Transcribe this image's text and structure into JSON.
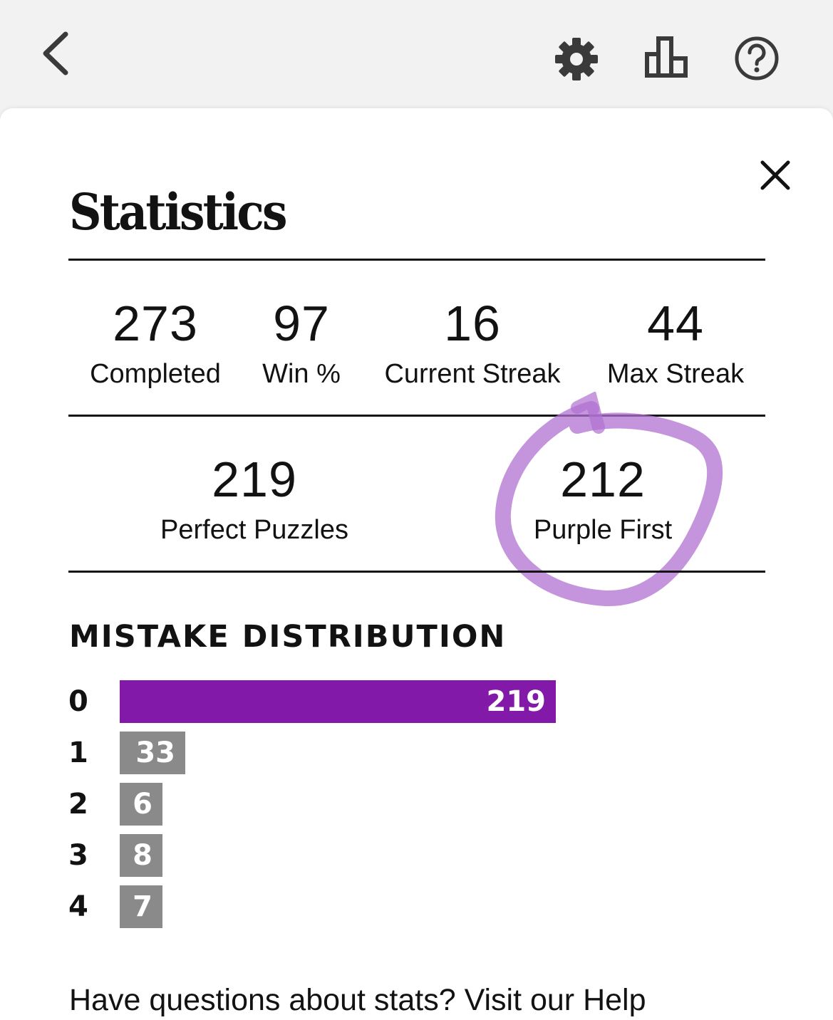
{
  "header": {
    "back_icon": "chevron-left-icon",
    "settings_icon": "gear-icon",
    "stats_icon": "bar-chart-icon",
    "help_icon": "question-circle-icon"
  },
  "modal": {
    "title": "Statistics",
    "close_icon": "close-icon"
  },
  "stats": {
    "completed": {
      "value": "273",
      "label": "Completed"
    },
    "win_pct": {
      "value": "97",
      "label": "Win %"
    },
    "current_streak": {
      "value": "16",
      "label": "Current Streak"
    },
    "max_streak": {
      "value": "44",
      "label": "Max Streak"
    },
    "perfect_puzzles": {
      "value": "219",
      "label": "Perfect Puzzles"
    },
    "purple_first": {
      "value": "212",
      "label": "Purple First"
    }
  },
  "distribution": {
    "title": "MISTAKE DISTRIBUTION",
    "rows": [
      {
        "mistakes": "0",
        "count": 219,
        "highlight": true
      },
      {
        "mistakes": "1",
        "count": 33,
        "highlight": false
      },
      {
        "mistakes": "2",
        "count": 6,
        "highlight": false
      },
      {
        "mistakes": "3",
        "count": 8,
        "highlight": false
      },
      {
        "mistakes": "4",
        "count": 7,
        "highlight": false
      }
    ]
  },
  "footer": {
    "help_text": "Have questions about stats? Visit our Help"
  },
  "colors": {
    "highlight_bar": "#8319a8",
    "default_bar": "#8a8a8a",
    "annotation": "#b070d0"
  }
}
